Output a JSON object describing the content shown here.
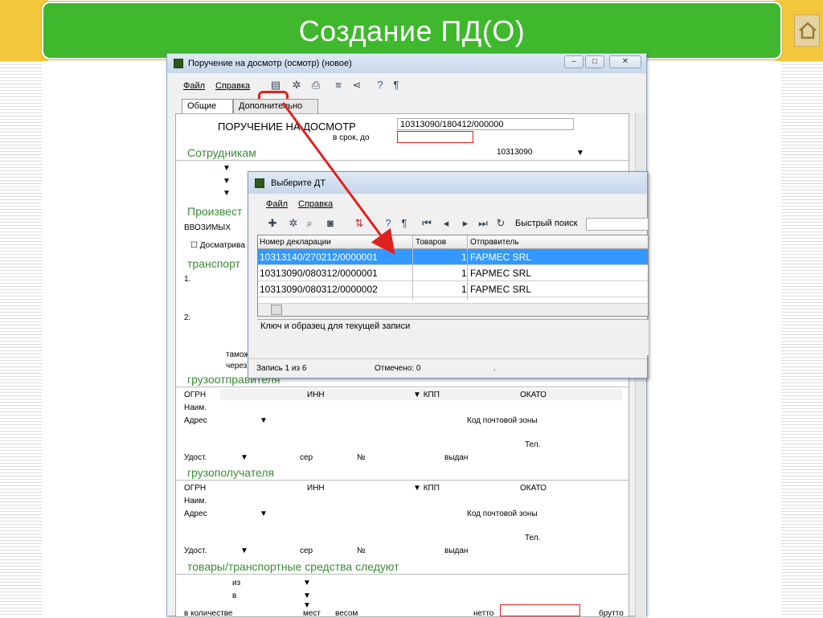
{
  "slide": {
    "title": "Создание ПД(О)"
  },
  "win": {
    "title": "Поручение на досмотр (осмотр) (новое)",
    "menu_file": "Файл",
    "menu_help": "Справка",
    "tab_general": "Общие",
    "tab_extra": "Дополнительно",
    "form_title": "ПОРУЧЕНИЕ НА ДОСМОТР",
    "form_number": "10313090/180412/000000",
    "deadline_label": "в срок, до",
    "sec_staff": "Сотрудникам",
    "staff_code": "10313090",
    "sec_produce": "Произвест",
    "produce_value": "ВВОЗИМЫХ",
    "inspect_check": "Досматрива",
    "sec_transport": "транспорт",
    "row1": "1.",
    "row2": "2.",
    "customs": "тамож",
    "through": "через",
    "sec_shipper": "грузоотправителя",
    "sec_consignee": "грузополучателя",
    "ogrn": "ОГРН",
    "inn": "ИНН",
    "kpp": "КПП",
    "okato": "ОКАТО",
    "name": "Наим.",
    "address": "Адрес",
    "postal": "Код почтовой зоны",
    "tel": "Тел.",
    "id_doc": "Удост.",
    "series": "сер",
    "num": "№",
    "issued": "выдан",
    "sec_goods": "товары/транспортные средства следуют",
    "from": "из",
    "to": "в",
    "qty": "в количестве",
    "places": "мест",
    "weight": "весом",
    "net": "нетто",
    "gross": "брутто"
  },
  "dlg": {
    "title": "Выберите ДТ",
    "menu_file": "Файл",
    "menu_help": "Справка",
    "quick_search": "Быстрый поиск",
    "columns": [
      "Номер декларации",
      "Товаров",
      "Отправитель"
    ],
    "rows": [
      [
        "10313140/270212/0000001",
        "1",
        "FAPMEC SRL"
      ],
      [
        "10313090/080312/0000001",
        "1",
        "FAPMEC SRL"
      ],
      [
        "10313090/080312/0000002",
        "1",
        "FAPMEC SRL"
      ]
    ],
    "key_panel": "Ключ и образец для текущей записи",
    "record": "Запись 1 из 6",
    "marked": "Отмечено: 0",
    "dot": "."
  },
  "colors": {
    "banner": "#3fb82e",
    "accent_red": "#e0211f",
    "selection": "#3399ff",
    "section_green": "#3b8b37"
  }
}
